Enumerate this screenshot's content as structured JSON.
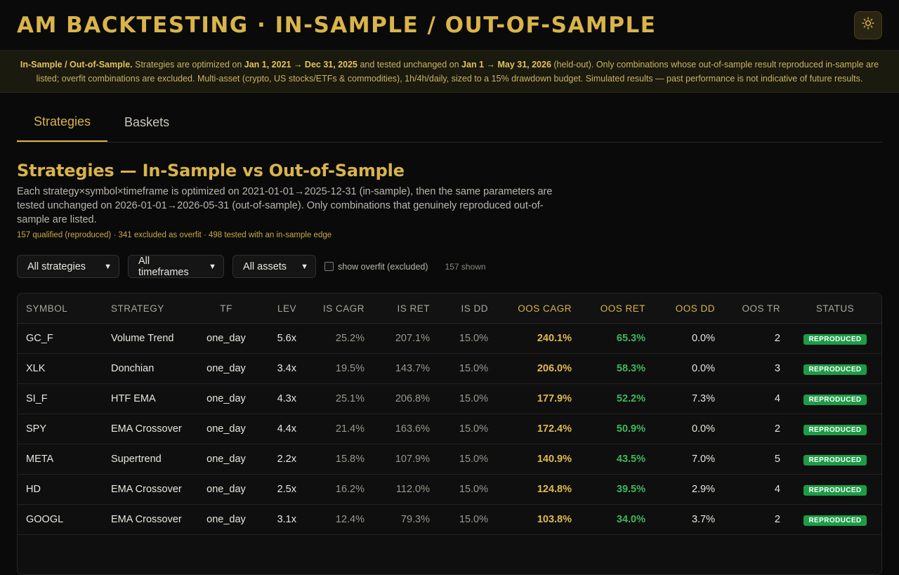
{
  "app": {
    "title": "AM BACKTESTING · IN-SAMPLE / OUT-OF-SAMPLE",
    "theme_icon": "sun-icon"
  },
  "banner": {
    "lead": "In-Sample / Out-of-Sample.",
    "t1": " Strategies are optimized on ",
    "is_range": "Jan 1, 2021 → Dec 31, 2025",
    "t2": " and tested unchanged on ",
    "oos_range": "Jan 1 → May 31, 2026",
    "t3": " (held-out). Only combinations whose out-of-sample result reproduced in-sample are listed; overfit combinations are excluded. Multi-asset (crypto, US stocks/ETFs & commodities), 1h/4h/daily, sized to a 15% drawdown budget. Simulated results — past performance is not indicative of future results."
  },
  "tabs": [
    {
      "label": "Strategies",
      "active": true
    },
    {
      "label": "Baskets",
      "active": false
    }
  ],
  "section": {
    "title": "Strategies — In-Sample vs Out-of-Sample",
    "description": "Each strategy×symbol×timeframe is optimized on 2021-01-01→2025-12-31 (in-sample), then the same parameters are tested unchanged on 2026-01-01→2026-05-31 (out-of-sample). Only combinations that genuinely reproduced out-of-sample are listed.",
    "stats": "157 qualified (reproduced) · 341 excluded as overfit · 498 tested with an in-sample edge"
  },
  "filters": {
    "strategy": "All strategies",
    "timeframe": "All timeframes",
    "asset": "All assets",
    "overfit_label": "show overfit (excluded)",
    "shown": "157 shown"
  },
  "table": {
    "headers": [
      "SYMBOL",
      "STRATEGY",
      "TF",
      "LEV",
      "IS CAGR",
      "IS RET",
      "IS DD",
      "OOS CAGR",
      "OOS RET",
      "OOS DD",
      "OOS TR",
      "STATUS"
    ],
    "rows": [
      [
        "GC_F",
        "Volume Trend",
        "one_day",
        "5.6x",
        "25.2%",
        "207.1%",
        "15.0%",
        "240.1%",
        "65.3%",
        "0.0%",
        "2",
        "REPRODUCED"
      ],
      [
        "XLK",
        "Donchian",
        "one_day",
        "3.4x",
        "19.5%",
        "143.7%",
        "15.0%",
        "206.0%",
        "58.3%",
        "0.0%",
        "3",
        "REPRODUCED"
      ],
      [
        "SI_F",
        "HTF EMA",
        "one_day",
        "4.3x",
        "25.1%",
        "206.8%",
        "15.0%",
        "177.9%",
        "52.2%",
        "7.3%",
        "4",
        "REPRODUCED"
      ],
      [
        "SPY",
        "EMA Crossover",
        "one_day",
        "4.4x",
        "21.4%",
        "163.6%",
        "15.0%",
        "172.4%",
        "50.9%",
        "0.0%",
        "2",
        "REPRODUCED"
      ],
      [
        "META",
        "Supertrend",
        "one_day",
        "2.2x",
        "15.8%",
        "107.9%",
        "15.0%",
        "140.9%",
        "43.5%",
        "7.0%",
        "5",
        "REPRODUCED"
      ],
      [
        "HD",
        "EMA Crossover",
        "one_day",
        "2.5x",
        "16.2%",
        "112.0%",
        "15.0%",
        "124.8%",
        "39.5%",
        "2.9%",
        "4",
        "REPRODUCED"
      ],
      [
        "GOOGL",
        "EMA Crossover",
        "one_day",
        "3.1x",
        "12.4%",
        "79.3%",
        "15.0%",
        "103.8%",
        "34.0%",
        "3.7%",
        "2",
        "REPRODUCED"
      ]
    ]
  },
  "colors": {
    "accent": "#d9b44a",
    "positive": "#3fb85a",
    "badge": "#1e9b47"
  }
}
